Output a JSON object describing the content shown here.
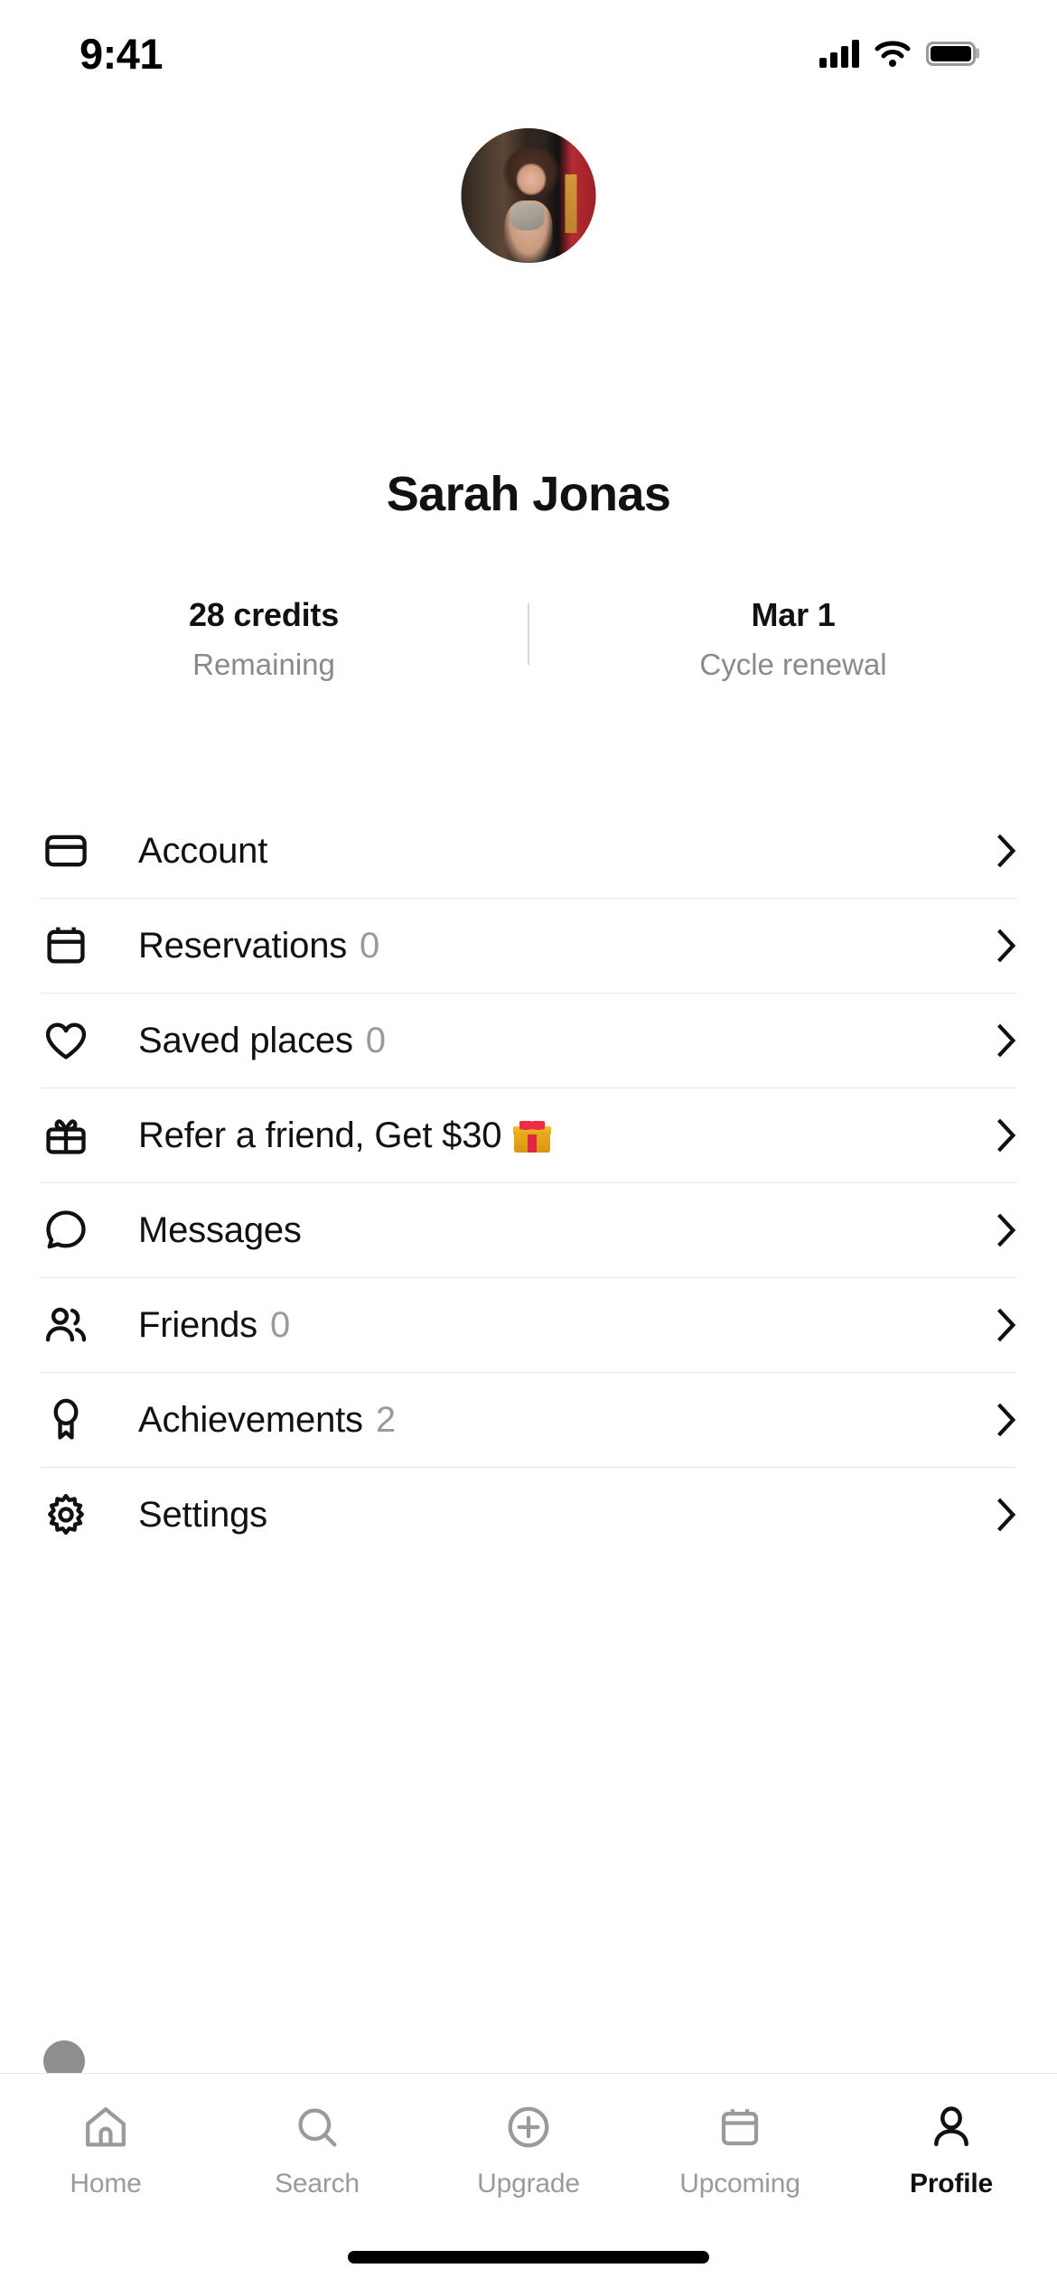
{
  "status_bar": {
    "time": "9:41",
    "signal_icon": "cellular-signal-icon",
    "wifi_icon": "wifi-icon",
    "battery_icon": "battery-icon"
  },
  "profile": {
    "avatar_alt": "user-avatar-photo",
    "name": "Sarah Jonas",
    "stats": [
      {
        "value": "28 credits",
        "label": "Remaining"
      },
      {
        "value": "Mar 1",
        "label": "Cycle renewal"
      }
    ]
  },
  "menu": {
    "items": [
      {
        "icon": "credit-card-icon",
        "label": "Account",
        "count": "",
        "emoji": "",
        "chevron": "chevron-right-icon"
      },
      {
        "icon": "calendar-icon",
        "label": "Reservations",
        "count": "0",
        "emoji": "",
        "chevron": "chevron-right-icon"
      },
      {
        "icon": "heart-icon",
        "label": "Saved places",
        "count": "0",
        "emoji": "",
        "chevron": "chevron-right-icon"
      },
      {
        "icon": "gift-icon",
        "label": "Refer a friend, Get $30",
        "count": "",
        "emoji": "gift-box-emoji",
        "chevron": "chevron-right-icon"
      },
      {
        "icon": "chat-bubble-icon",
        "label": "Messages",
        "count": "",
        "emoji": "",
        "chevron": "chevron-right-icon"
      },
      {
        "icon": "people-icon",
        "label": "Friends",
        "count": "0",
        "emoji": "",
        "chevron": "chevron-right-icon"
      },
      {
        "icon": "medal-icon",
        "label": "Achievements",
        "count": "2",
        "emoji": "",
        "chevron": "chevron-right-icon"
      },
      {
        "icon": "gear-icon",
        "label": "Settings",
        "count": "",
        "emoji": "",
        "chevron": "chevron-right-icon"
      }
    ]
  },
  "tab_bar": {
    "items": [
      {
        "icon": "home-icon",
        "label": "Home",
        "active": false
      },
      {
        "icon": "search-icon",
        "label": "Search",
        "active": false
      },
      {
        "icon": "plus-circle-icon",
        "label": "Upgrade",
        "active": false
      },
      {
        "icon": "calendar-icon",
        "label": "Upcoming",
        "active": false
      },
      {
        "icon": "person-icon",
        "label": "Profile",
        "active": true
      }
    ]
  },
  "colors": {
    "text_primary": "#111111",
    "text_muted": "#9a9a9a",
    "divider": "#e6e6e6",
    "background": "#ffffff",
    "accent_red": "#e0293f",
    "accent_gold": "#f0b21e"
  }
}
